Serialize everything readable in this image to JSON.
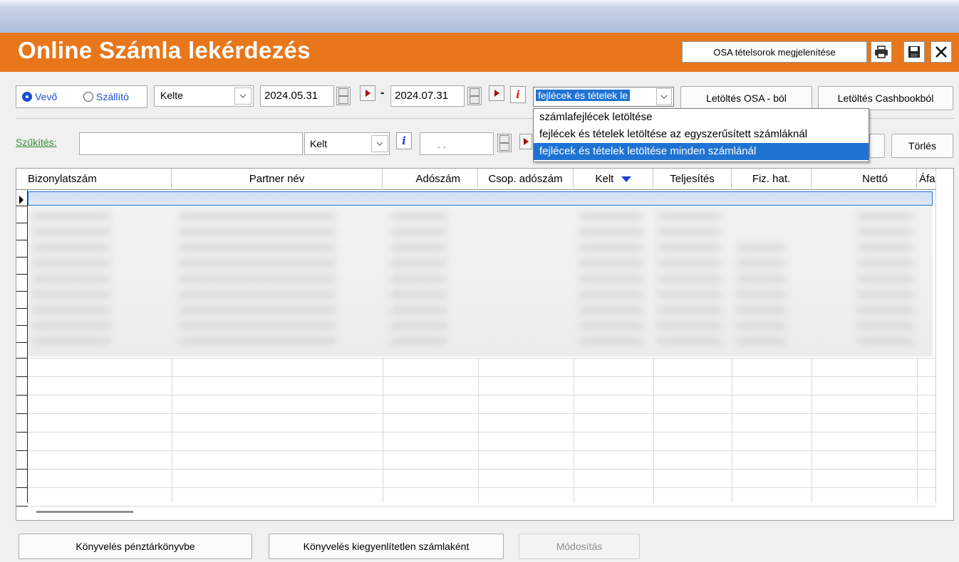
{
  "window": {
    "title": "Online Számla lekérdezés",
    "osa_button_label": "OSA tételsorok megjelenítése",
    "print_icon": "printer-icon",
    "save_icon": "floppy-disk-icon",
    "close_icon": "close-icon"
  },
  "toolbar": {
    "radio_buyer": "Vevő",
    "radio_supplier": "Szállító",
    "selected_radio": "Vevő",
    "date_field_combo": "Kelte",
    "date_from": "2024.05.31",
    "date_separator": "-",
    "date_to": "2024.07.31",
    "info_glyph": "i",
    "download_mode_value": "fejlécek és tételek le",
    "download_osa_label": "Letöltés OSA - ból",
    "download_cashbook_label": "Letöltés Cashbookból"
  },
  "download_mode_options": [
    "számlafejlécek letöltése",
    "fejlécek és tételek letöltése az egyszerűsített számláknál",
    "fejlécek és tételek letöltése minden számlánál"
  ],
  "download_mode_selected_index": 2,
  "filter": {
    "label": "Szűkítés:",
    "text_value": "",
    "field_combo": "Kelt",
    "info_glyph": "i",
    "date_value": ". .",
    "clear_label": "Törlés"
  },
  "table": {
    "columns": [
      "Bizonylatszám",
      "Partner név",
      "Adószám",
      "Csop. adószám",
      "Kelt",
      "Teljesítés",
      "Fiz. hat.",
      "Nettó",
      "Áfa"
    ],
    "sort_column": "Kelt",
    "sort_direction": "descending",
    "blurred_row_count": 9,
    "empty_row_count": 9
  },
  "bottom_buttons": {
    "book_cash": "Könyvelés pénztárkönyvbe",
    "book_unsettled": "Könyvelés kiegyenlítetlen számlaként",
    "modify": "Módosítás"
  },
  "colors": {
    "title_bar": "#e8761a",
    "selection": "#1e73d2",
    "radio_selected": "#1a4fd6",
    "filter_label": "#2f8a2f",
    "sort_arrow": "#1a3fd0",
    "play_arrow": "#a01010",
    "info_red": "#e02020",
    "info_blue": "#2040d0"
  }
}
